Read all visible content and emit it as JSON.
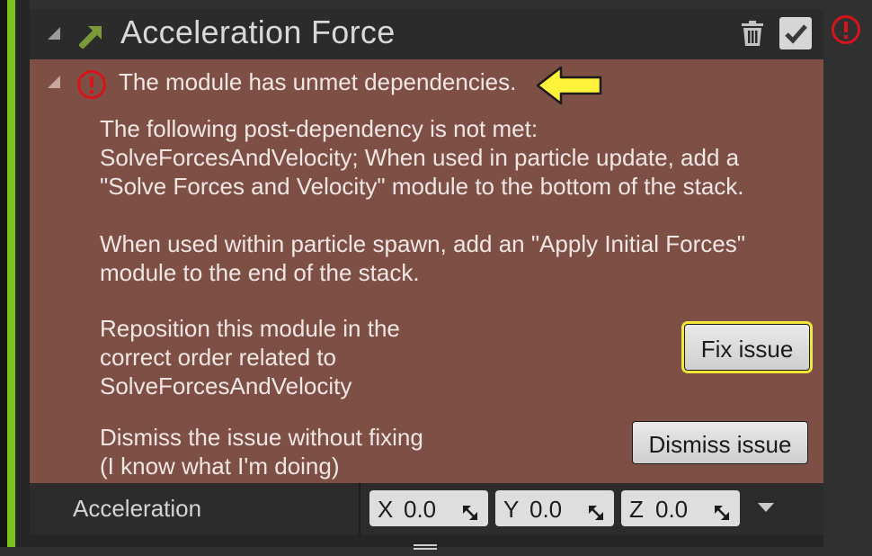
{
  "module": {
    "title": "Acceleration Force",
    "enabled": true
  },
  "issue": {
    "summary": "The module has unmet dependencies.",
    "description_1": "The following post-dependency is not met:\nSolveForcesAndVelocity; When used in particle update, add a\n\"Solve Forces and Velocity\" module to the bottom of the stack.",
    "description_2": "When used within particle spawn, add an \"Apply Initial Forces\"\nmodule to the end of the stack.",
    "fix_text": "Reposition this module in the\ncorrect order related to\nSolveForcesAndVelocity",
    "fix_button": "Fix issue",
    "dismiss_text": "Dismiss the issue without fixing\n(I know what I'm doing)",
    "dismiss_button": "Dismiss issue"
  },
  "property": {
    "label": "Acceleration",
    "x": {
      "axis": "X",
      "value": "0.0"
    },
    "y": {
      "axis": "Y",
      "value": "0.0"
    },
    "z": {
      "axis": "Z",
      "value": "0.0"
    }
  },
  "colors": {
    "accent_green": "#7cc21c",
    "issue_background": "#7e4f45",
    "error_red": "#d8141b",
    "highlight_yellow": "#f3e83a",
    "arrow_yellow": "#fff23a"
  },
  "icons": [
    "collapse-triangle-icon",
    "module-arrow-icon",
    "trash-icon",
    "checkmark-icon",
    "error-icon",
    "pointer-arrow-icon",
    "resize-arrows-icon",
    "chevron-down-icon"
  ]
}
